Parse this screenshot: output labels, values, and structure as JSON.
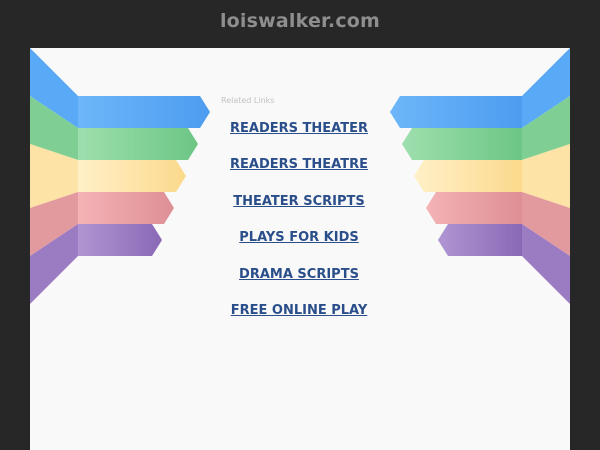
{
  "header": {
    "domain": "loiswalker.com"
  },
  "related": {
    "label": "Related Links",
    "links": [
      {
        "label": "READERS THEATER"
      },
      {
        "label": "READERS THEATRE"
      },
      {
        "label": "THEATER SCRIPTS"
      },
      {
        "label": "PLAYS FOR KIDS"
      },
      {
        "label": "DRAMA SCRIPTS"
      },
      {
        "label": "FREE ONLINE PLAY"
      }
    ]
  },
  "colors": {
    "page_background": "#272727",
    "panel_background": "#f9f9f9",
    "link": "#2a4e8a",
    "ribbon_blue": "#5aa9f7",
    "ribbon_green": "#86d39a",
    "ribbon_yellow": "#fde2a1",
    "ribbon_red": "#e79a9f",
    "ribbon_purple": "#9d7cc4"
  }
}
